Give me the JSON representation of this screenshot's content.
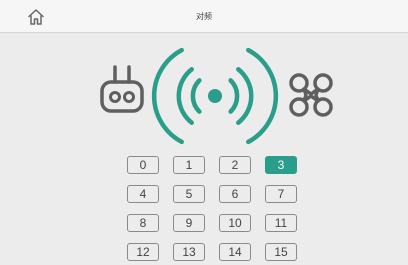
{
  "header": {
    "title": "对频",
    "home_icon": "home-icon"
  },
  "colors": {
    "accent": "#2a9e8a",
    "icon_gray": "#5f5f5f",
    "background": "#ececec",
    "header_bg": "#f6f6f6"
  },
  "icons": {
    "controller": "remote-controller-icon",
    "signal": "wireless-signal-icon",
    "drone": "drone-icon"
  },
  "channels": {
    "selected": "3",
    "items": [
      "0",
      "1",
      "2",
      "3",
      "4",
      "5",
      "6",
      "7",
      "8",
      "9",
      "10",
      "11",
      "12",
      "13",
      "14",
      "15"
    ]
  }
}
